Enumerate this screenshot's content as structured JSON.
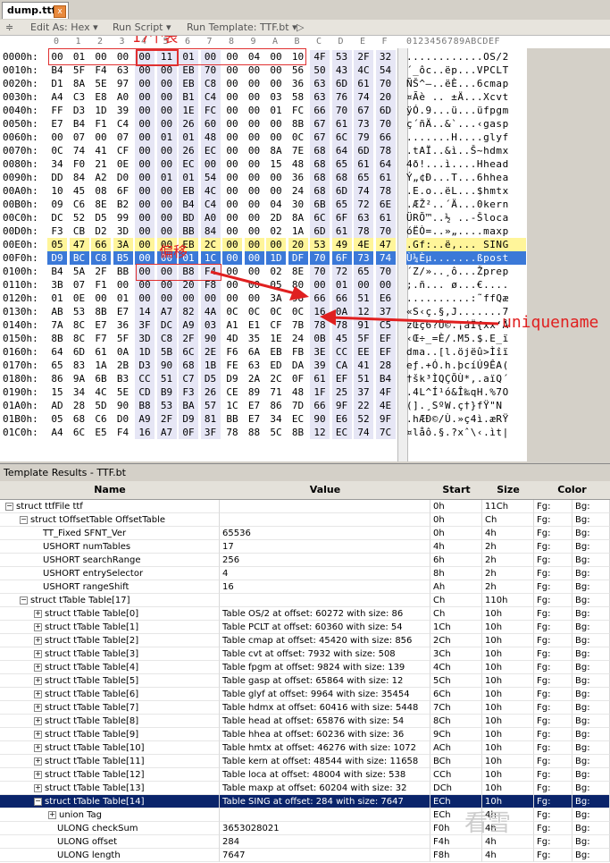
{
  "window": {
    "tab_title": "dump.ttf",
    "close_glyph": "x"
  },
  "toolbar": {
    "edit_as": "Edit As: Hex ▾",
    "run_script": "Run Script ▾",
    "run_template": "Run Template: TTF.bt ▾",
    "play": "▷"
  },
  "hex": {
    "col_headers": [
      "0",
      "1",
      "2",
      "3",
      "4",
      "5",
      "6",
      "7",
      "8",
      "9",
      "A",
      "B",
      "C",
      "D",
      "E",
      "F"
    ],
    "ascii_header": "0123456789ABCDEF",
    "rows": [
      {
        "addr": "0000h:",
        "bytes": [
          "00",
          "01",
          "00",
          "00",
          "00",
          "11",
          "01",
          "00",
          "00",
          "04",
          "00",
          "10",
          "4F",
          "53",
          "2F",
          "32"
        ],
        "ascii": "............OS/2"
      },
      {
        "addr": "0010h:",
        "bytes": [
          "B4",
          "5F",
          "F4",
          "63",
          "00",
          "00",
          "EB",
          "70",
          "00",
          "00",
          "00",
          "56",
          "50",
          "43",
          "4C",
          "54"
        ],
        "ascii": "´_ôc..ëp...VPCLT"
      },
      {
        "addr": "0020h:",
        "bytes": [
          "D1",
          "8A",
          "5E",
          "97",
          "00",
          "00",
          "EB",
          "C8",
          "00",
          "00",
          "00",
          "36",
          "63",
          "6D",
          "61",
          "70"
        ],
        "ascii": "ÑŠ^—..ëÈ...6cmap"
      },
      {
        "addr": "0030h:",
        "bytes": [
          "A4",
          "C3",
          "E8",
          "A0",
          "00",
          "00",
          "B1",
          "C4",
          "00",
          "00",
          "03",
          "58",
          "63",
          "76",
          "74",
          "20"
        ],
        "ascii": "¤Ãè .. ±Ä...Xcvt "
      },
      {
        "addr": "0040h:",
        "bytes": [
          "FF",
          "D3",
          "1D",
          "39",
          "00",
          "00",
          "1E",
          "FC",
          "00",
          "00",
          "01",
          "FC",
          "66",
          "70",
          "67",
          "6D"
        ],
        "ascii": "ÿÓ.9...ü...üfpgm"
      },
      {
        "addr": "0050h:",
        "bytes": [
          "E7",
          "B4",
          "F1",
          "C4",
          "00",
          "00",
          "26",
          "60",
          "00",
          "00",
          "00",
          "8B",
          "67",
          "61",
          "73",
          "70"
        ],
        "ascii": "ç´ñÄ..&`...‹gasp"
      },
      {
        "addr": "0060h:",
        "bytes": [
          "00",
          "07",
          "00",
          "07",
          "00",
          "01",
          "01",
          "48",
          "00",
          "00",
          "00",
          "0C",
          "67",
          "6C",
          "79",
          "66"
        ],
        "ascii": ".......H....glyf"
      },
      {
        "addr": "0070h:",
        "bytes": [
          "0C",
          "74",
          "41",
          "CF",
          "00",
          "00",
          "26",
          "EC",
          "00",
          "00",
          "8A",
          "7E",
          "68",
          "64",
          "6D",
          "78"
        ],
        "ascii": ".tAÏ..&ì..Š~hdmx"
      },
      {
        "addr": "0080h:",
        "bytes": [
          "34",
          "F0",
          "21",
          "0E",
          "00",
          "00",
          "EC",
          "00",
          "00",
          "00",
          "15",
          "48",
          "68",
          "65",
          "61",
          "64"
        ],
        "ascii": "4ð!...ì....Hhead"
      },
      {
        "addr": "0090h:",
        "bytes": [
          "DD",
          "84",
          "A2",
          "D0",
          "00",
          "01",
          "01",
          "54",
          "00",
          "00",
          "00",
          "36",
          "68",
          "68",
          "65",
          "61"
        ],
        "ascii": "Ý„¢Ð...T...6hhea"
      },
      {
        "addr": "00A0h:",
        "bytes": [
          "10",
          "45",
          "08",
          "6F",
          "00",
          "00",
          "EB",
          "4C",
          "00",
          "00",
          "00",
          "24",
          "68",
          "6D",
          "74",
          "78"
        ],
        "ascii": ".E.o..ëL...$hmtx"
      },
      {
        "addr": "00B0h:",
        "bytes": [
          "09",
          "C6",
          "8E",
          "B2",
          "00",
          "00",
          "B4",
          "C4",
          "00",
          "00",
          "04",
          "30",
          "6B",
          "65",
          "72",
          "6E"
        ],
        "ascii": ".ÆŽ²..´Ä...0kern"
      },
      {
        "addr": "00C0h:",
        "bytes": [
          "DC",
          "52",
          "D5",
          "99",
          "00",
          "00",
          "BD",
          "A0",
          "00",
          "00",
          "2D",
          "8A",
          "6C",
          "6F",
          "63",
          "61"
        ],
        "ascii": "ÜRÕ™..½ ..-Šloca"
      },
      {
        "addr": "00D0h:",
        "bytes": [
          "F3",
          "CB",
          "D2",
          "3D",
          "00",
          "00",
          "BB",
          "84",
          "00",
          "00",
          "02",
          "1A",
          "6D",
          "61",
          "78",
          "70"
        ],
        "ascii": "óËÒ=..»„....maxp"
      },
      {
        "addr": "00E0h:",
        "bytes": [
          "05",
          "47",
          "66",
          "3A",
          "00",
          "00",
          "EB",
          "2C",
          "00",
          "00",
          "00",
          "20",
          "53",
          "49",
          "4E",
          "47"
        ],
        "ascii": ".Gf:..ë,... SING"
      },
      {
        "addr": "00F0h:",
        "bytes": [
          "D9",
          "BC",
          "C8",
          "B5",
          "00",
          "00",
          "01",
          "1C",
          "00",
          "00",
          "1D",
          "DF",
          "70",
          "6F",
          "73",
          "74"
        ],
        "ascii": "Ù¼Èµ.......ßpost"
      },
      {
        "addr": "0100h:",
        "bytes": [
          "B4",
          "5A",
          "2F",
          "BB",
          "00",
          "00",
          "B8",
          "F4",
          "00",
          "00",
          "02",
          "8E",
          "70",
          "72",
          "65",
          "70"
        ],
        "ascii": "´Z/»..¸ô...Žprep"
      },
      {
        "addr": "0110h:",
        "bytes": [
          "3B",
          "07",
          "F1",
          "00",
          "00",
          "00",
          "20",
          "F8",
          "00",
          "00",
          "05",
          "80",
          "00",
          "01",
          "00",
          "00"
        ],
        "ascii": ";.ñ... ø...€...."
      },
      {
        "addr": "0120h:",
        "bytes": [
          "01",
          "0E",
          "00",
          "01",
          "00",
          "00",
          "00",
          "00",
          "00",
          "00",
          "3A",
          "98",
          "66",
          "66",
          "51",
          "E6"
        ],
        "ascii": "..........:˜ffQæ"
      },
      {
        "addr": "0130h:",
        "bytes": [
          "AB",
          "53",
          "8B",
          "E7",
          "14",
          "A7",
          "82",
          "4A",
          "0C",
          "0C",
          "0C",
          "0C",
          "16",
          "0A",
          "12",
          "37"
        ],
        "ascii": "«S‹ç.§‚J.......7"
      },
      {
        "addr": "0140h:",
        "bytes": [
          "7A",
          "8C",
          "E7",
          "36",
          "3F",
          "DC",
          "A9",
          "03",
          "A1",
          "E1",
          "CF",
          "7B",
          "78",
          "78",
          "91",
          "C5"
        ],
        "ascii": "zŒç6?Ü©.¡áÏ{xx‘Å"
      },
      {
        "addr": "0150h:",
        "bytes": [
          "8B",
          "8C",
          "F7",
          "5F",
          "3D",
          "C8",
          "2F",
          "90",
          "4D",
          "35",
          "1E",
          "24",
          "0B",
          "45",
          "5F",
          "EF"
        ],
        "ascii": "‹Œ÷_=È/.M5.$.E_ï"
      },
      {
        "addr": "0160h:",
        "bytes": [
          "64",
          "6D",
          "61",
          "0A",
          "1D",
          "5B",
          "6C",
          "2E",
          "F6",
          "6A",
          "EB",
          "FB",
          "3E",
          "CC",
          "EE",
          "EF"
        ],
        "ascii": "dma..[l.öjëû>Ìîï"
      },
      {
        "addr": "0170h:",
        "bytes": [
          "65",
          "83",
          "1A",
          "2B",
          "D3",
          "90",
          "68",
          "1B",
          "FE",
          "63",
          "ED",
          "DA",
          "39",
          "CA",
          "41",
          "28"
        ],
        "ascii": "eƒ.+Ó.h.þcíÚ9ÊA("
      },
      {
        "addr": "0180h:",
        "bytes": [
          "86",
          "9A",
          "6B",
          "B3",
          "CC",
          "51",
          "C7",
          "D5",
          "D9",
          "2A",
          "2C",
          "0F",
          "61",
          "EF",
          "51",
          "B4"
        ],
        "ascii": "†šk³ÌQÇÕÙ*,.aïQ´"
      },
      {
        "addr": "0190h:",
        "bytes": [
          "15",
          "34",
          "4C",
          "5E",
          "CD",
          "B9",
          "F3",
          "26",
          "CE",
          "89",
          "71",
          "48",
          "1F",
          "25",
          "37",
          "4F"
        ],
        "ascii": ".4L^Í¹ó&Î‰qH.%7O"
      },
      {
        "addr": "01A0h:",
        "bytes": [
          "AD",
          "28",
          "5D",
          "90",
          "B8",
          "53",
          "BA",
          "57",
          "1C",
          "E7",
          "86",
          "7D",
          "66",
          "9F",
          "22",
          "4E"
        ],
        "ascii": "­(].¸SºW.ç†}fŸ\"N"
      },
      {
        "addr": "01B0h:",
        "bytes": [
          "05",
          "68",
          "C6",
          "D0",
          "A9",
          "2F",
          "D9",
          "81",
          "BB",
          "E7",
          "34",
          "EC",
          "90",
          "E6",
          "52",
          "9F"
        ],
        "ascii": ".hÆÐ©/Ù.»ç4ì.æRŸ"
      },
      {
        "addr": "01C0h:",
        "bytes": [
          "A4",
          "6C",
          "E5",
          "F4",
          "16",
          "A7",
          "0F",
          "3F",
          "78",
          "88",
          "5C",
          "8B",
          "12",
          "EC",
          "74",
          "7C"
        ],
        "ascii": "¤låô.§.?xˆ\\‹.ìt|"
      }
    ]
  },
  "annotations": {
    "tables17": "17个表",
    "offset": "偏移",
    "uniquename": "uniquename"
  },
  "pane_title": "Template Results - TTF.bt",
  "grid": {
    "headers": {
      "name": "Name",
      "value": "Value",
      "start": "Start",
      "size": "Size",
      "color": "Color"
    },
    "rows": [
      {
        "name": "struct ttfFile ttf",
        "value": "",
        "start": "0h",
        "size": "11Ch",
        "fg": "Fg:",
        "bg": "Bg:",
        "indent": 0,
        "pm": "−"
      },
      {
        "name": "struct tOffsetTable OffsetTable",
        "value": "",
        "start": "0h",
        "size": "Ch",
        "fg": "Fg:",
        "bg": "Bg:",
        "indent": 1,
        "pm": "−"
      },
      {
        "name": "TT_Fixed SFNT_Ver",
        "value": "65536",
        "start": "0h",
        "size": "4h",
        "fg": "Fg:",
        "bg": "Bg:",
        "indent": 2,
        "pm": ""
      },
      {
        "name": "USHORT numTables",
        "value": "17",
        "start": "4h",
        "size": "2h",
        "fg": "Fg:",
        "bg": "Bg:",
        "indent": 2,
        "pm": ""
      },
      {
        "name": "USHORT searchRange",
        "value": "256",
        "start": "6h",
        "size": "2h",
        "fg": "Fg:",
        "bg": "Bg:",
        "indent": 2,
        "pm": ""
      },
      {
        "name": "USHORT entrySelector",
        "value": "4",
        "start": "8h",
        "size": "2h",
        "fg": "Fg:",
        "bg": "Bg:",
        "indent": 2,
        "pm": ""
      },
      {
        "name": "USHORT rangeShift",
        "value": "16",
        "start": "Ah",
        "size": "2h",
        "fg": "Fg:",
        "bg": "Bg:",
        "indent": 2,
        "pm": ""
      },
      {
        "name": "struct tTable Table[17]",
        "value": "",
        "start": "Ch",
        "size": "110h",
        "fg": "Fg:",
        "bg": "Bg:",
        "indent": 1,
        "pm": "−"
      },
      {
        "name": "struct tTable Table[0]",
        "value": "Table OS/2 at offset: 60272 with size: 86",
        "start": "Ch",
        "size": "10h",
        "fg": "Fg:",
        "bg": "Bg:",
        "indent": 2,
        "pm": "+"
      },
      {
        "name": "struct tTable Table[1]",
        "value": "Table PCLT at offset: 60360 with size: 54",
        "start": "1Ch",
        "size": "10h",
        "fg": "Fg:",
        "bg": "Bg:",
        "indent": 2,
        "pm": "+"
      },
      {
        "name": "struct tTable Table[2]",
        "value": "Table cmap at offset: 45420 with size: 856",
        "start": "2Ch",
        "size": "10h",
        "fg": "Fg:",
        "bg": "Bg:",
        "indent": 2,
        "pm": "+"
      },
      {
        "name": "struct tTable Table[3]",
        "value": "Table cvt  at offset: 7932 with size: 508",
        "start": "3Ch",
        "size": "10h",
        "fg": "Fg:",
        "bg": "Bg:",
        "indent": 2,
        "pm": "+"
      },
      {
        "name": "struct tTable Table[4]",
        "value": "Table fpgm at offset: 9824 with size: 139",
        "start": "4Ch",
        "size": "10h",
        "fg": "Fg:",
        "bg": "Bg:",
        "indent": 2,
        "pm": "+"
      },
      {
        "name": "struct tTable Table[5]",
        "value": "Table gasp at offset: 65864 with size: 12",
        "start": "5Ch",
        "size": "10h",
        "fg": "Fg:",
        "bg": "Bg:",
        "indent": 2,
        "pm": "+"
      },
      {
        "name": "struct tTable Table[6]",
        "value": "Table glyf at offset: 9964 with size: 35454",
        "start": "6Ch",
        "size": "10h",
        "fg": "Fg:",
        "bg": "Bg:",
        "indent": 2,
        "pm": "+"
      },
      {
        "name": "struct tTable Table[7]",
        "value": "Table hdmx at offset: 60416 with size: 5448",
        "start": "7Ch",
        "size": "10h",
        "fg": "Fg:",
        "bg": "Bg:",
        "indent": 2,
        "pm": "+"
      },
      {
        "name": "struct tTable Table[8]",
        "value": "Table head at offset: 65876 with size: 54",
        "start": "8Ch",
        "size": "10h",
        "fg": "Fg:",
        "bg": "Bg:",
        "indent": 2,
        "pm": "+"
      },
      {
        "name": "struct tTable Table[9]",
        "value": "Table hhea at offset: 60236 with size: 36",
        "start": "9Ch",
        "size": "10h",
        "fg": "Fg:",
        "bg": "Bg:",
        "indent": 2,
        "pm": "+"
      },
      {
        "name": "struct tTable Table[10]",
        "value": "Table hmtx at offset: 46276 with size: 1072",
        "start": "ACh",
        "size": "10h",
        "fg": "Fg:",
        "bg": "Bg:",
        "indent": 2,
        "pm": "+"
      },
      {
        "name": "struct tTable Table[11]",
        "value": "Table kern at offset: 48544 with size: 11658",
        "start": "BCh",
        "size": "10h",
        "fg": "Fg:",
        "bg": "Bg:",
        "indent": 2,
        "pm": "+"
      },
      {
        "name": "struct tTable Table[12]",
        "value": "Table loca at offset: 48004 with size: 538",
        "start": "CCh",
        "size": "10h",
        "fg": "Fg:",
        "bg": "Bg:",
        "indent": 2,
        "pm": "+"
      },
      {
        "name": "struct tTable Table[13]",
        "value": "Table maxp at offset: 60204 with size: 32",
        "start": "DCh",
        "size": "10h",
        "fg": "Fg:",
        "bg": "Bg:",
        "indent": 2,
        "pm": "+"
      },
      {
        "name": "struct tTable Table[14]",
        "value": "Table SING at offset: 284 with size: 7647",
        "start": "ECh",
        "size": "10h",
        "fg": "Fg:",
        "bg": "Bg:",
        "indent": 2,
        "pm": "−",
        "selected": true
      },
      {
        "name": "union Tag",
        "value": "",
        "start": "ECh",
        "size": "4h",
        "fg": "Fg:",
        "bg": "Bg:",
        "indent": 3,
        "pm": "+"
      },
      {
        "name": "ULONG checkSum",
        "value": "3653028021",
        "start": "F0h",
        "size": "4h",
        "fg": "Fg:",
        "bg": "Bg:",
        "indent": 3,
        "pm": ""
      },
      {
        "name": "ULONG offset",
        "value": "284",
        "start": "F4h",
        "size": "4h",
        "fg": "Fg:",
        "bg": "Bg:",
        "indent": 3,
        "pm": ""
      },
      {
        "name": "ULONG length",
        "value": "7647",
        "start": "F8h",
        "size": "4h",
        "fg": "Fg:",
        "bg": "Bg:",
        "indent": 3,
        "pm": ""
      }
    ]
  },
  "watermark": "看雪",
  "colors": {
    "annotation": "#e02020",
    "selection": "#0a246a",
    "highlight_yellow": "#fff59a",
    "highlight_blue": "#3b79d8"
  }
}
